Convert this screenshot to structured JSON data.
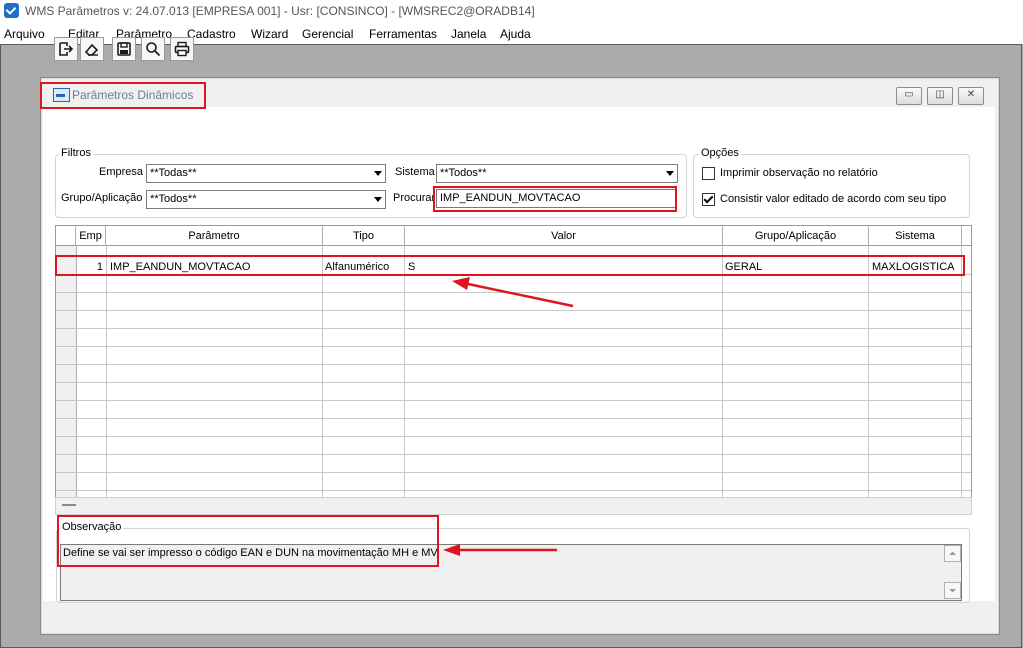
{
  "app": {
    "title": "WMS Parâmetros  v: 24.07.013   [EMPRESA 001] - Usr: [CONSINCO] - [WMSREC2@ORADB14]"
  },
  "menu": [
    "Arquivo",
    "Editar",
    "Parâmetro",
    "Cadastro",
    "Wizard",
    "Gerencial",
    "Ferramentas",
    "Janela",
    "Ajuda"
  ],
  "window": {
    "title": "Parâmetros Dinâmicos"
  },
  "toolbar": {
    "icons": [
      "exit-icon",
      "eraser-icon",
      "save-icon",
      "search-icon",
      "print-icon"
    ]
  },
  "filters": {
    "label": "Filtros",
    "empresa_label": "Empresa",
    "empresa_value": "**Todas**",
    "sistema_label": "Sistema",
    "sistema_value": "**Todos**",
    "grupo_label": "Grupo/Aplicação",
    "grupo_value": "**Todos**",
    "procurar_label": "Procurar",
    "procurar_value": "IMP_EANDUN_MOVTACAO"
  },
  "options": {
    "label": "Opções",
    "imprimir_label": "Imprimir observação no relatório",
    "imprimir_checked": false,
    "consistir_label": "Consistir valor editado de acordo com seu tipo",
    "consistir_checked": true
  },
  "grid": {
    "headers": [
      "Emp",
      "Parâmetro",
      "Tipo",
      "Valor",
      "Grupo/Aplicação",
      "Sistema"
    ],
    "rows": [
      {
        "emp": "1",
        "parametro": "IMP_EANDUN_MOVTACAO",
        "tipo": "Alfanumérico",
        "valor": "S",
        "grupo": "GERAL",
        "sistema": "MAXLOGISTICA"
      }
    ]
  },
  "observacao": {
    "label": "Observação",
    "text": "Define se vai ser impresso o código EAN e DUN na movimentação MH e MV"
  },
  "colors": {
    "annotation": "#e0141e",
    "mdi_background": "#ababab"
  }
}
